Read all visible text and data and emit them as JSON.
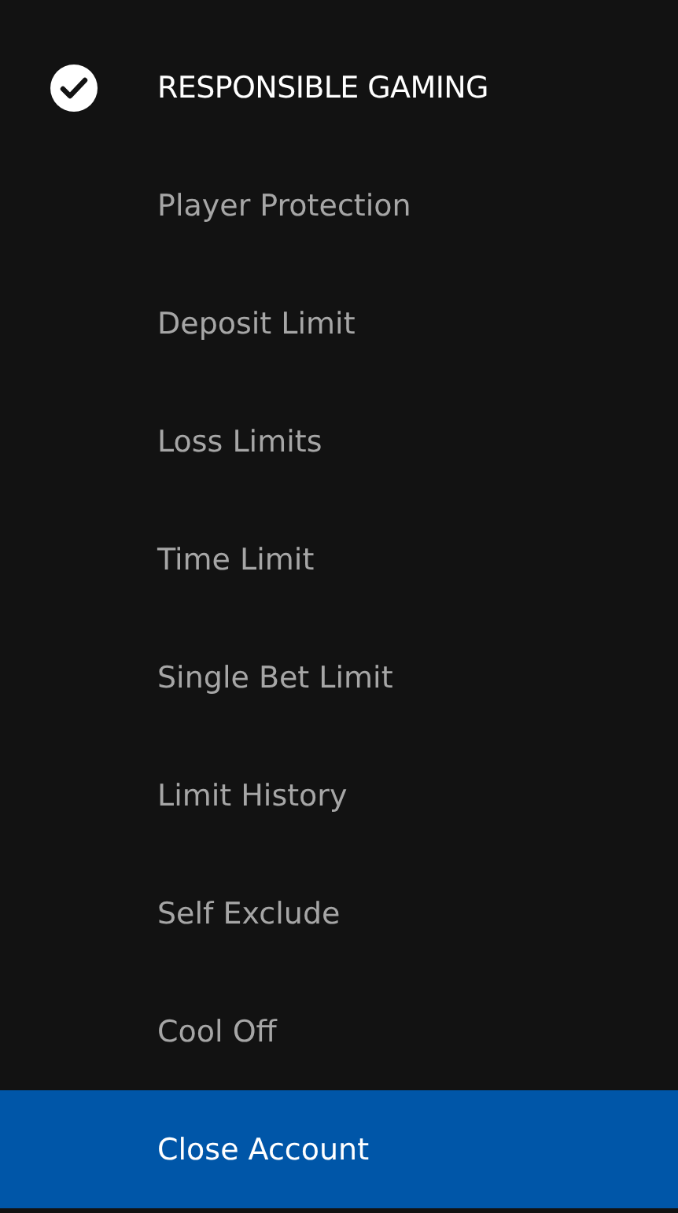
{
  "menu": {
    "title": "RESPONSIBLE GAMING",
    "items": [
      {
        "label": "Player Protection",
        "selected": false
      },
      {
        "label": "Deposit Limit",
        "selected": false
      },
      {
        "label": "Loss Limits",
        "selected": false
      },
      {
        "label": "Time Limit",
        "selected": false
      },
      {
        "label": "Single Bet Limit",
        "selected": false
      },
      {
        "label": "Limit History",
        "selected": false
      },
      {
        "label": "Self Exclude",
        "selected": false
      },
      {
        "label": "Cool Off",
        "selected": false
      },
      {
        "label": "Close Account",
        "selected": true
      }
    ]
  }
}
